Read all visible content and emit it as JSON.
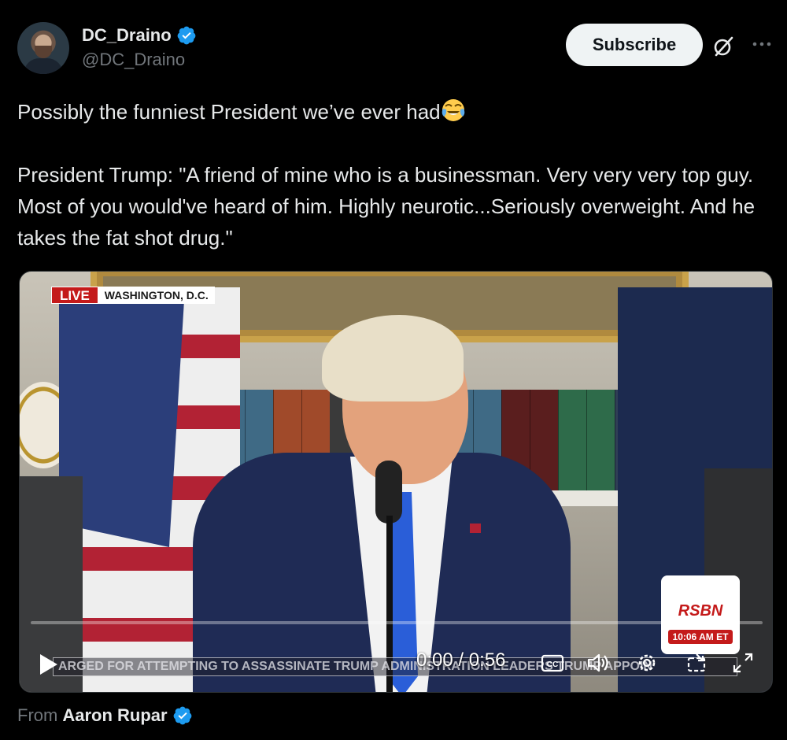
{
  "author": {
    "display_name": "DC_Draino",
    "handle": "@DC_Draino",
    "verified": true
  },
  "actions": {
    "subscribe_label": "Subscribe",
    "grok_icon": "grok-icon",
    "more_icon": "more-icon"
  },
  "post": {
    "line1": "Possibly the funniest President we’ve ever had",
    "line1_emoji": "face-with-tears-of-joy",
    "quote": "President Trump: \"A friend of mine who is a businessman. Very very very top guy. Most of you would've heard of him. Highly neurotic...Seriously overweight. And he takes the fat shot drug.\""
  },
  "video": {
    "live_label": "LIVE",
    "location": "WASHINGTON, D.C.",
    "network": "RSBN",
    "clock": "10:06 AM ET",
    "ticker": "ARGED FOR ATTEMPTING TO ASSASSINATE TRUMP ADMINISTRATION LEADERS   TRUMP APPOIN",
    "time_display": "0:00 / 0:56",
    "progress": 0,
    "icons": [
      "play-icon",
      "closed-captions-icon",
      "volume-icon",
      "settings-icon",
      "picture-in-picture-icon",
      "fullscreen-icon"
    ]
  },
  "attribution": {
    "prefix": "From",
    "source_name": "Aaron Rupar",
    "verified": true
  },
  "colors": {
    "background": "#000000",
    "text": "#e7e9ea",
    "muted": "#71767b",
    "verified_blue": "#1d9bf0",
    "live_red": "#c41a1a"
  }
}
